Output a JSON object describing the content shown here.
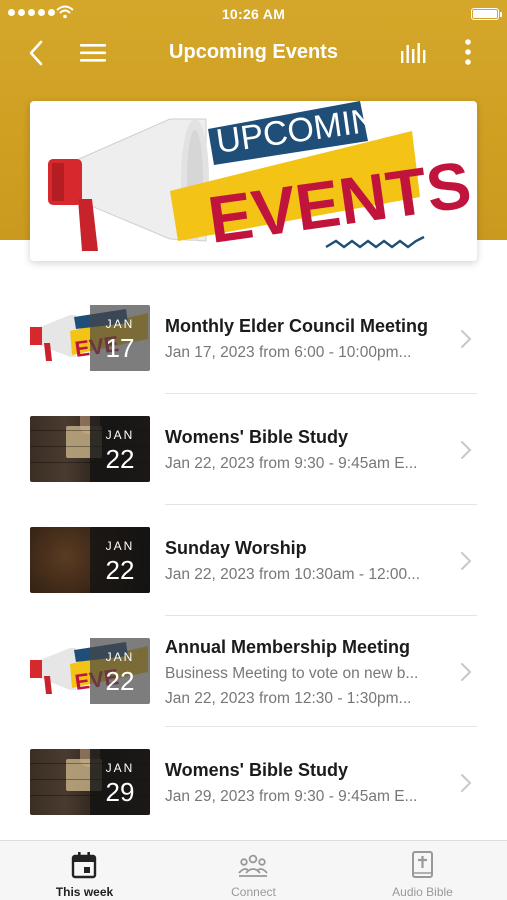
{
  "status_bar": {
    "time": "10:26 AM"
  },
  "nav": {
    "title": "Upcoming Events"
  },
  "banner": {
    "line1": "UPCOMING",
    "line2": "EVENTS"
  },
  "events": [
    {
      "title": "Monthly Elder Council Meeting",
      "lines": [
        "Jan 17, 2023 from 6:00 - 10:00pm..."
      ],
      "month": "JAN",
      "day": "17",
      "thumb": "promo"
    },
    {
      "title": "Womens' Bible Study",
      "lines": [
        "Jan 22, 2023 from 9:30 - 9:45am E..."
      ],
      "month": "JAN",
      "day": "22",
      "thumb": "wood"
    },
    {
      "title": "Sunday Worship",
      "lines": [
        "Jan 22, 2023 from 10:30am - 12:00..."
      ],
      "month": "JAN",
      "day": "22",
      "thumb": "dark"
    },
    {
      "title": "Annual Membership Meeting",
      "lines": [
        "Business Meeting to vote on new b...",
        "Jan 22, 2023 from 12:30 - 1:30pm..."
      ],
      "month": "JAN",
      "day": "22",
      "thumb": "promo"
    },
    {
      "title": "Womens' Bible Study",
      "lines": [
        "Jan 29, 2023 from 9:30 - 9:45am E..."
      ],
      "month": "JAN",
      "day": "29",
      "thumb": "wood"
    }
  ],
  "tabs": [
    {
      "label": "This week",
      "icon": "calendar-icon",
      "active": true
    },
    {
      "label": "Connect",
      "icon": "people-group-icon",
      "active": false
    },
    {
      "label": "Audio Bible",
      "icon": "bible-icon",
      "active": false
    }
  ],
  "colors": {
    "header": "#cf9f22",
    "banner_blue": "#1f4e79",
    "banner_red": "#c0143c",
    "banner_yellow": "#f3c316"
  }
}
